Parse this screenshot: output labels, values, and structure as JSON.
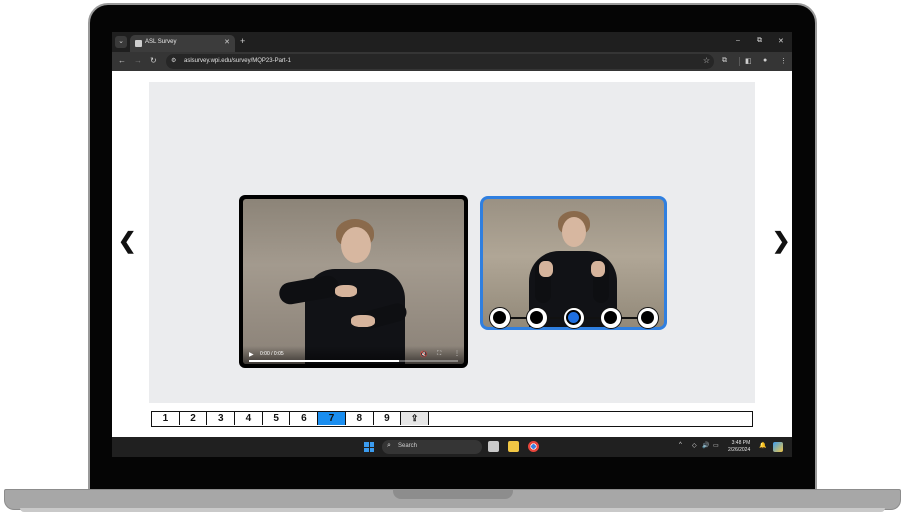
{
  "browser": {
    "tab_title": "ASL Survey",
    "tab_close": "✕",
    "new_tab": "+",
    "menu_icon": "⌄",
    "url": "aslsurvey.wpi.edu/survey/MQP23-Part-1",
    "controls": {
      "minimize": "–",
      "restore": "⧉",
      "close": "✕"
    }
  },
  "toolbar": {
    "back": "←",
    "forward": "→",
    "reload": "↻",
    "site_info": "⚙",
    "star": "☆",
    "extensions": "⧉",
    "sidepanel": "◧",
    "profile": "●",
    "menu": "⋮"
  },
  "page": {
    "nav_prev": "❮",
    "nav_next": "❯",
    "video": {
      "time": "0:00 / 0:05",
      "progress": 0.72,
      "play": "▶",
      "mute": "🔇",
      "fullscreen": "⛶",
      "more": "⋮"
    },
    "rating_scale": {
      "count": 5,
      "selected_index": 2
    },
    "pager": {
      "pages": [
        "1",
        "2",
        "3",
        "4",
        "5",
        "6",
        "7",
        "8",
        "9"
      ],
      "active": "7",
      "upload_icon": "⇪"
    }
  },
  "taskbar": {
    "search_label": "Search",
    "search_icon": "⌕",
    "tray": {
      "chevron": "^",
      "wifi": "◇",
      "volume": "🔊",
      "battery": "▭",
      "bell": "🔔"
    },
    "time": "3:48 PM",
    "date": "2/26/2024"
  },
  "colors": {
    "accent_blue": "#1a8ef0",
    "reference_border": "#2f7fe0",
    "stage_bg": "#ebecee"
  }
}
